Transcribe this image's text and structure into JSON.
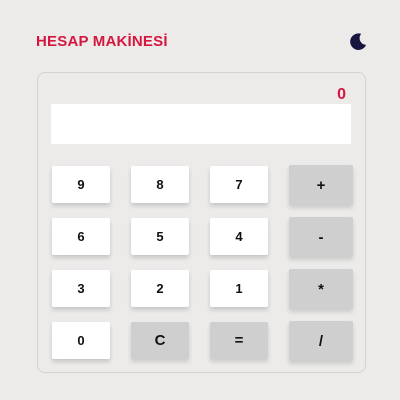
{
  "header": {
    "title": "HESAP MAKİNESİ",
    "theme_toggle_icon": "moon-icon"
  },
  "calculator": {
    "result": "0",
    "input_value": "",
    "keys": [
      {
        "label": "9",
        "kind": "digit"
      },
      {
        "label": "8",
        "kind": "digit"
      },
      {
        "label": "7",
        "kind": "digit"
      },
      {
        "label": "+",
        "kind": "operator"
      },
      {
        "label": "6",
        "kind": "digit"
      },
      {
        "label": "5",
        "kind": "digit"
      },
      {
        "label": "4",
        "kind": "digit"
      },
      {
        "label": "-",
        "kind": "operator"
      },
      {
        "label": "3",
        "kind": "digit"
      },
      {
        "label": "2",
        "kind": "digit"
      },
      {
        "label": "1",
        "kind": "digit"
      },
      {
        "label": "*",
        "kind": "operator"
      },
      {
        "label": "0",
        "kind": "digit"
      },
      {
        "label": "C",
        "kind": "clear"
      },
      {
        "label": "=",
        "kind": "equals"
      },
      {
        "label": "/",
        "kind": "operator"
      }
    ]
  },
  "colors": {
    "accent": "#d5173f",
    "background": "#ecebea",
    "moon": "#16163f",
    "digit_key": "#ffffff",
    "operator_key": "#cfcfcf"
  }
}
